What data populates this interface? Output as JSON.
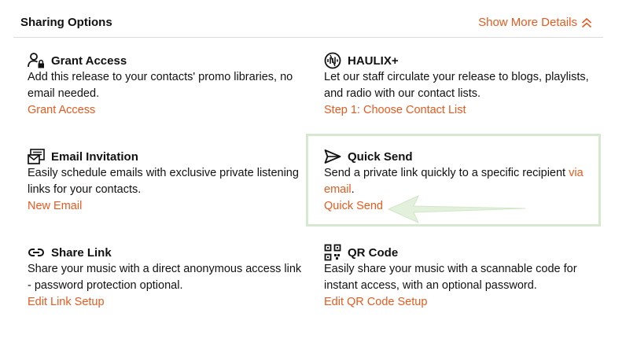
{
  "header": {
    "title": "Sharing Options",
    "toggle_label": "Show More Details"
  },
  "options": [
    {
      "title": "Grant Access",
      "description": "Add this release to your contacts' promo libraries, no email needed.",
      "action": "Grant Access",
      "icon": "user-lock-icon"
    },
    {
      "title": "HAULIX+",
      "description": "Let our staff circulate your release to blogs, playlists, and radio with our contact lists.",
      "action": "Step 1: Choose Contact List",
      "icon": "haulix-logo-icon"
    },
    {
      "title": "Email Invitation",
      "description": "Easily schedule emails with exclusive private listening links for your contacts.",
      "action": "New Email",
      "icon": "envelope-list-icon"
    },
    {
      "title": "Quick Send",
      "description_prefix": "Send a private link quickly to a specific recipient ",
      "description_link": "via email",
      "description_suffix": ".",
      "action": "Quick Send",
      "icon": "paper-plane-icon"
    },
    {
      "title": "Share Link",
      "description": "Share your music with a direct anonymous access link - password protection optional.",
      "action": "Edit Link Setup",
      "icon": "link-icon"
    },
    {
      "title": "QR Code",
      "description": "Easily share your music with a scannable code for instant access, with an optional password.",
      "action": "Edit QR Code Setup",
      "icon": "qr-code-icon"
    }
  ],
  "colors": {
    "accent": "#e85a1e",
    "highlight": "#d6e8cf"
  }
}
